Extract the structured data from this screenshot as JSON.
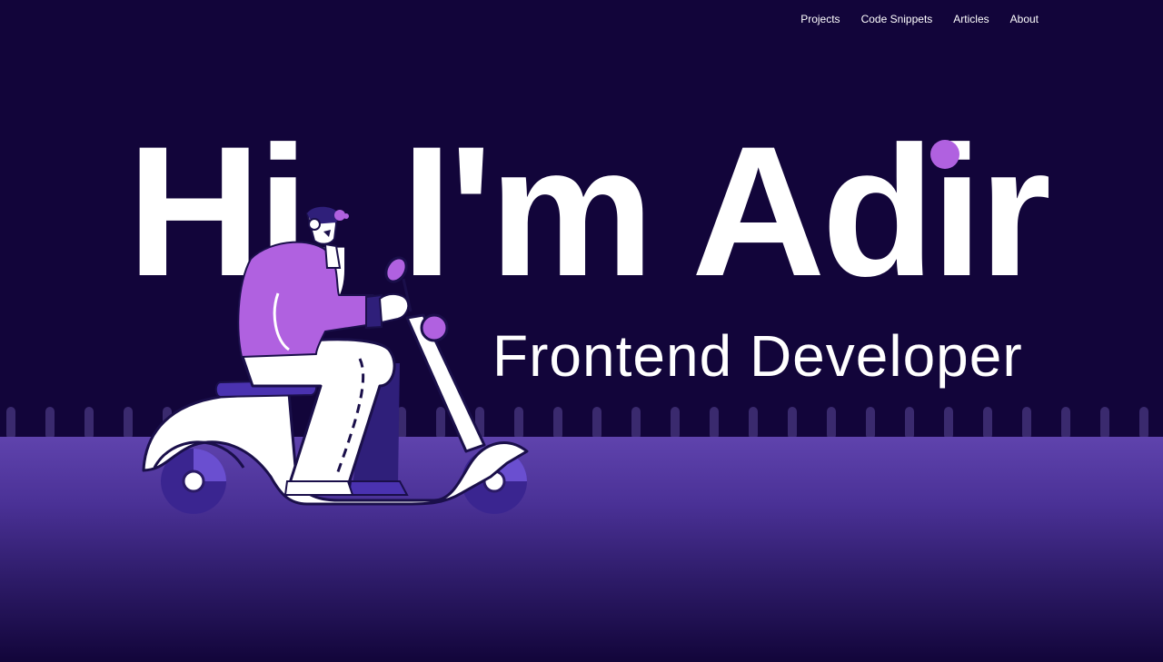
{
  "nav": {
    "items": [
      {
        "label": "Projects"
      },
      {
        "label": "Code Snippets"
      },
      {
        "label": "Articles"
      },
      {
        "label": "About"
      }
    ]
  },
  "hero": {
    "title": "Hi, I'm Adir",
    "subtitle": "Frontend Developer"
  },
  "colors": {
    "background": "#12053a",
    "accent": "#b061e0",
    "ground": "#5f43ad",
    "text": "#ffffff"
  },
  "illustration": {
    "name": "person-on-scooter-illustration"
  }
}
